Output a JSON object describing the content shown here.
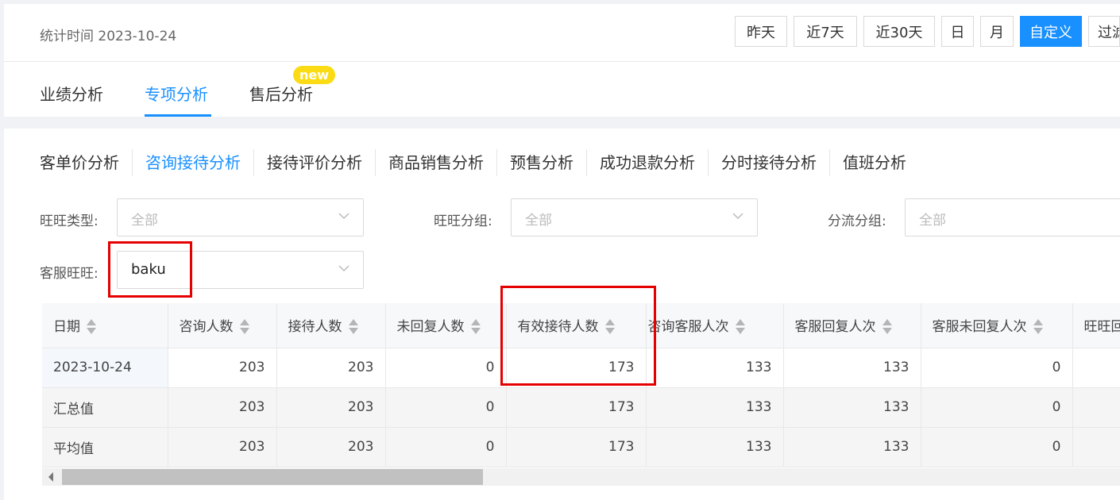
{
  "header": {
    "stat_time": "统计时间 2023-10-24",
    "ranges": [
      {
        "label": "昨天",
        "active": false
      },
      {
        "label": "近7天",
        "active": false
      },
      {
        "label": "近30天",
        "active": false
      },
      {
        "label": "日",
        "active": false
      },
      {
        "label": "月",
        "active": false
      },
      {
        "label": "自定义",
        "active": true
      },
      {
        "label": "过滤",
        "active": false
      }
    ]
  },
  "main_tabs": [
    {
      "label": "业绩分析",
      "active": false
    },
    {
      "label": "专项分析",
      "active": true
    },
    {
      "label": "售后分析",
      "active": false
    }
  ],
  "new_badge": "new",
  "sub_tabs": [
    {
      "label": "客单价分析",
      "active": false
    },
    {
      "label": "咨询接待分析",
      "active": true
    },
    {
      "label": "接待评价分析",
      "active": false
    },
    {
      "label": "商品销售分析",
      "active": false
    },
    {
      "label": "预售分析",
      "active": false
    },
    {
      "label": "成功退款分析",
      "active": false
    },
    {
      "label": "分时接待分析",
      "active": false
    },
    {
      "label": "值班分析",
      "active": false
    }
  ],
  "filters": {
    "wangwang_type": {
      "label": "旺旺类型:",
      "value": "全部"
    },
    "wangwang_group": {
      "label": "旺旺分组:",
      "value": "全部"
    },
    "diversion_group": {
      "label": "分流分组:",
      "value": "全部"
    },
    "service_wangwang": {
      "label": "客服旺旺:",
      "value": "baku"
    }
  },
  "table": {
    "columns": [
      "日期",
      "咨询人数",
      "接待人数",
      "未回复人数",
      "有效接待人数",
      "咨询客服人次",
      "客服回复人次",
      "客服未回复人次",
      "旺旺回"
    ],
    "rows": [
      {
        "type": "data",
        "cells": [
          "2023-10-24",
          "203",
          "203",
          "0",
          "173",
          "133",
          "133",
          "0",
          ""
        ]
      },
      {
        "type": "sum",
        "cells": [
          "汇总值",
          "203",
          "203",
          "0",
          "173",
          "133",
          "133",
          "0",
          ""
        ]
      },
      {
        "type": "sum",
        "cells": [
          "平均值",
          "203",
          "203",
          "0",
          "173",
          "133",
          "133",
          "0",
          ""
        ]
      }
    ]
  },
  "colors": {
    "accent": "#1890ff",
    "highlight_box": "#e60000",
    "badge": "#fadb14"
  }
}
